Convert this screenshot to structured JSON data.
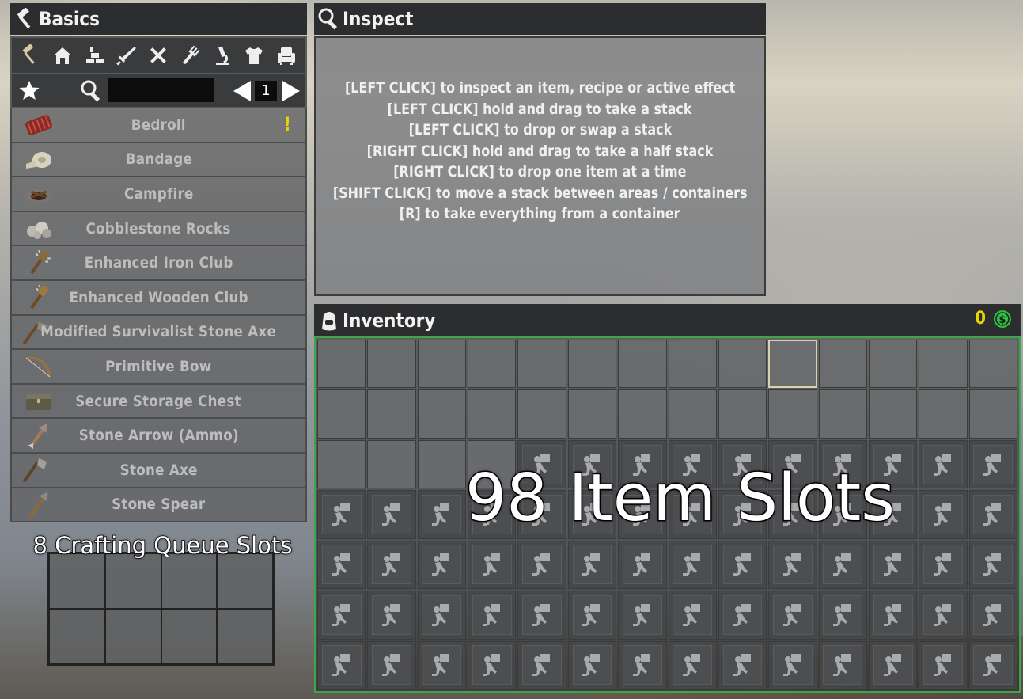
{
  "basics": {
    "title": "Basics",
    "categories": [
      "hammer-icon",
      "house-icon",
      "bricks-icon",
      "sword-icon",
      "tools-icon",
      "fork-icon",
      "microscope-icon",
      "shirt-icon",
      "armchair-icon"
    ],
    "search_placeholder": "",
    "page": "1",
    "recipes": [
      {
        "label": "Bedroll",
        "icon": "bedroll-icon",
        "alert": "!"
      },
      {
        "label": "Bandage",
        "icon": "bandage-icon"
      },
      {
        "label": "Campfire",
        "icon": "campfire-icon"
      },
      {
        "label": "Cobblestone Rocks",
        "icon": "rocks-icon"
      },
      {
        "label": "Enhanced Iron Club",
        "icon": "club-icon"
      },
      {
        "label": "Enhanced Wooden Club",
        "icon": "club-icon"
      },
      {
        "label": "Modified Survivalist Stone Axe",
        "icon": "axe-icon"
      },
      {
        "label": "Primitive Bow",
        "icon": "bow-icon"
      },
      {
        "label": "Secure Storage Chest",
        "icon": "chest-icon"
      },
      {
        "label": "Stone Arrow (Ammo)",
        "icon": "arrow-icon"
      },
      {
        "label": "Stone Axe",
        "icon": "axe-icon"
      },
      {
        "label": "Stone Spear",
        "icon": "spear-icon"
      }
    ]
  },
  "queue": {
    "title": "8 Crafting Queue Slots",
    "slot_count": 8
  },
  "inspect": {
    "title": "Inspect",
    "help_lines": [
      "[LEFT CLICK] to inspect an item, recipe or active effect",
      "[LEFT CLICK] hold and drag to take a stack",
      "[LEFT CLICK] to drop or swap a stack",
      "[RIGHT CLICK] hold and drag to take a half stack",
      "[RIGHT CLICK] to drop one item at a time",
      "[SHIFT CLICK] to move a stack between areas / containers",
      "[R] to take everything from a container"
    ]
  },
  "inventory": {
    "title": "Inventory",
    "coins": "0",
    "caption": "98 Item Slots",
    "columns": 14,
    "rows": 7,
    "open_slots": 32,
    "selected_slot": 9,
    "locked_icon": "encumbrance-icon",
    "accent_color": "#3fa54a"
  }
}
